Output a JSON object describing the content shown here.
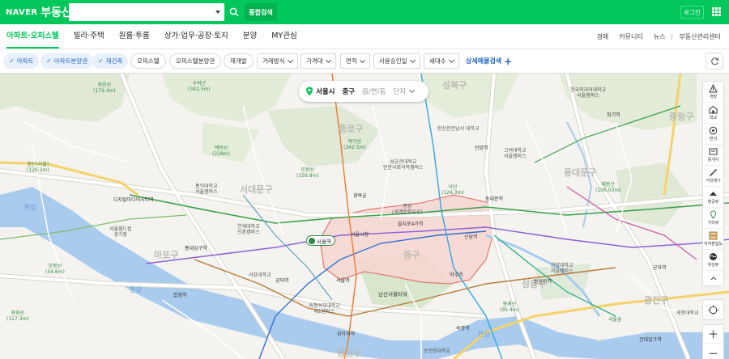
{
  "header": {
    "logo_naver": "NAVER",
    "logo_service": "부동산",
    "search_value": "",
    "search_placeholder": "",
    "total_search_label": "통합검색",
    "login_label": "로그인",
    "search_icon": "search-icon",
    "apps_icon": "apps-grid-icon",
    "brand_color": "#03c75a"
  },
  "nav": {
    "main": [
      {
        "label": "아파트·오피스텔",
        "active": true
      },
      {
        "label": "빌라·주택",
        "active": false
      },
      {
        "label": "원룸·투룸",
        "active": false
      },
      {
        "label": "상가·업무·공장·토지",
        "active": false
      },
      {
        "label": "분양",
        "active": false
      },
      {
        "label": "MY관심",
        "active": false
      }
    ],
    "right": [
      "경매",
      "커뮤니티",
      "뉴스",
      "부동산관리센터"
    ]
  },
  "filters": {
    "chips_on": [
      "아파트",
      "아파트분양권",
      "재건축"
    ],
    "chips_off": [
      "오피스텔",
      "오피스텔분양권",
      "재개발"
    ],
    "dropdowns": [
      "거래방식",
      "가격대",
      "면적",
      "사용승인일",
      "세대수"
    ],
    "advanced_label": "상세매물검색",
    "refresh_icon": "refresh-icon"
  },
  "map": {
    "breadcrumb": {
      "city": "서울시",
      "district": "중구",
      "dong": "읍/면/동",
      "complex": "단지"
    },
    "districts": [
      "종로구",
      "성북구",
      "중랑구",
      "동대문구",
      "마포구",
      "용산구",
      "성동구",
      "광진구",
      "서대문구",
      "중구"
    ],
    "rivers": [
      "한강"
    ],
    "places": [
      {
        "name": "북한산\n(179.4m)",
        "green": true
      },
      {
        "name": "수락산\n(342.5m)",
        "green": true
      },
      {
        "name": "북악산\n(342.5m)",
        "green": true
      },
      {
        "name": "인왕산\n(339.8m)",
        "green": true
      },
      {
        "name": "낙산\n(124.3m)",
        "green": true
      },
      {
        "name": "매봉산\n(106.03m)",
        "green": true
      },
      {
        "name": "남산서울타워",
        "green": false
      },
      {
        "name": "봉래산\n(95.4m)",
        "green": true
      },
      {
        "name": "응봉산\n(54.6m)",
        "green": true
      },
      {
        "name": "용화산\n(117.3m)",
        "green": true
      },
      {
        "name": "백련산\n(228m)",
        "green": true
      },
      {
        "name": "서울숲",
        "green": true
      },
      {
        "name": "증산(서울)\n(126.2m)",
        "green": true
      },
      {
        "name": "서울월드컵\n경기장",
        "green": false
      },
      {
        "name": "디지털미디어시티역",
        "green": false
      },
      {
        "name": "성균관대학교\n인문사회과학캠퍼스",
        "green": false
      },
      {
        "name": "고려대학교\n서울캠퍼스",
        "green": false
      },
      {
        "name": "한국외국어대학교\n서울캠퍼스",
        "green": false
      },
      {
        "name": "연세대학교\n신촌캠퍼스",
        "green": false
      },
      {
        "name": "서강대학교",
        "green": false
      },
      {
        "name": "홍익대학교\n서울캠퍼스",
        "green": false
      },
      {
        "name": "숙명여자대학교\n제1캠퍼스",
        "green": false
      },
      {
        "name": "서울시청",
        "green": false
      },
      {
        "name": "동대문역",
        "green": false
      },
      {
        "name": "신당역",
        "green": false
      },
      {
        "name": "왕십리역",
        "green": false
      },
      {
        "name": "서울역",
        "green": false
      },
      {
        "name": "약수역",
        "green": false
      },
      {
        "name": "경복궁",
        "green": false
      },
      {
        "name": "중앙\n(세계문화유산)",
        "green": false
      },
      {
        "name": "한신한전남서 대학교",
        "green": false
      },
      {
        "name": "홍대입구역",
        "green": false
      },
      {
        "name": "합정역",
        "green": false
      },
      {
        "name": "공덕역",
        "green": false
      },
      {
        "name": "삼각지역",
        "green": false
      },
      {
        "name": "숙명역",
        "green": false
      },
      {
        "name": "건대입구역",
        "green": false
      },
      {
        "name": "군자역",
        "green": false
      },
      {
        "name": "안암역",
        "green": false
      },
      {
        "name": "회기역",
        "green": false
      },
      {
        "name": "을지로4가역",
        "green": false
      },
      {
        "name": "한양대학교\n서울캠퍼스",
        "green": false
      },
      {
        "name": "세종대학교",
        "green": false
      },
      {
        "name": "순천향대학교",
        "green": false
      }
    ],
    "station_pin": "서울역",
    "tools": [
      {
        "label": "개발",
        "icon": "development-icon"
      },
      {
        "label": "학교",
        "icon": "school-icon"
      },
      {
        "label": "편의",
        "icon": "convenience-icon"
      },
      {
        "label": "중개사",
        "icon": "agent-icon"
      },
      {
        "label": "거리재기",
        "icon": "ruler-icon"
      },
      {
        "label": "항공뷰",
        "icon": "aerial-view-icon"
      },
      {
        "label": "거리뷰",
        "icon": "street-view-icon"
      },
      {
        "label": "지적편집도",
        "icon": "cadastral-map-icon"
      },
      {
        "label": "위성뷰",
        "icon": "satellite-icon"
      }
    ],
    "zoom_in": "+",
    "zoom_out": "−"
  }
}
